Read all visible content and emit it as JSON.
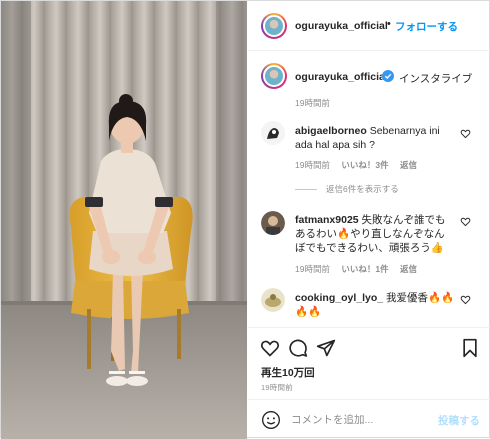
{
  "header": {
    "username": "ogurayuka_official",
    "separator": "•",
    "follow_label": "フォローする"
  },
  "caption": {
    "username": "ogurayuka_official",
    "text": "インスタライブ",
    "time": "19時間前",
    "verified_icon": "verified-badge-icon"
  },
  "comments": [
    {
      "username": "abigaelborneo",
      "text": "Sebenarnya ini ada hal apa sih ?",
      "time": "19時間前",
      "likes": "いいね！3件",
      "reply_label": "返信",
      "view_replies": "返信6件を表示する"
    },
    {
      "username": "fatmanx9025",
      "text": "失敗なんぞ誰でもあるわい🔥やり直しなんぞなんぼでもできるわい、頑張ろう👍",
      "time": "19時間前",
      "likes": "いいね！1件",
      "reply_label": "返信"
    },
    {
      "username": "cooking_oyl_lyo_",
      "text": "我爱優香🔥🔥🔥🔥",
      "time": ""
    }
  ],
  "actions": {
    "views": "再生10万回",
    "time": "19時間前"
  },
  "comment_box": {
    "placeholder": "コメントを追加...",
    "post_label": "投稿する"
  },
  "colors": {
    "accent": "#0095f6",
    "post_disabled": "#b2dffc",
    "chair": "#e8b63a",
    "border": "#dbdbdb"
  }
}
